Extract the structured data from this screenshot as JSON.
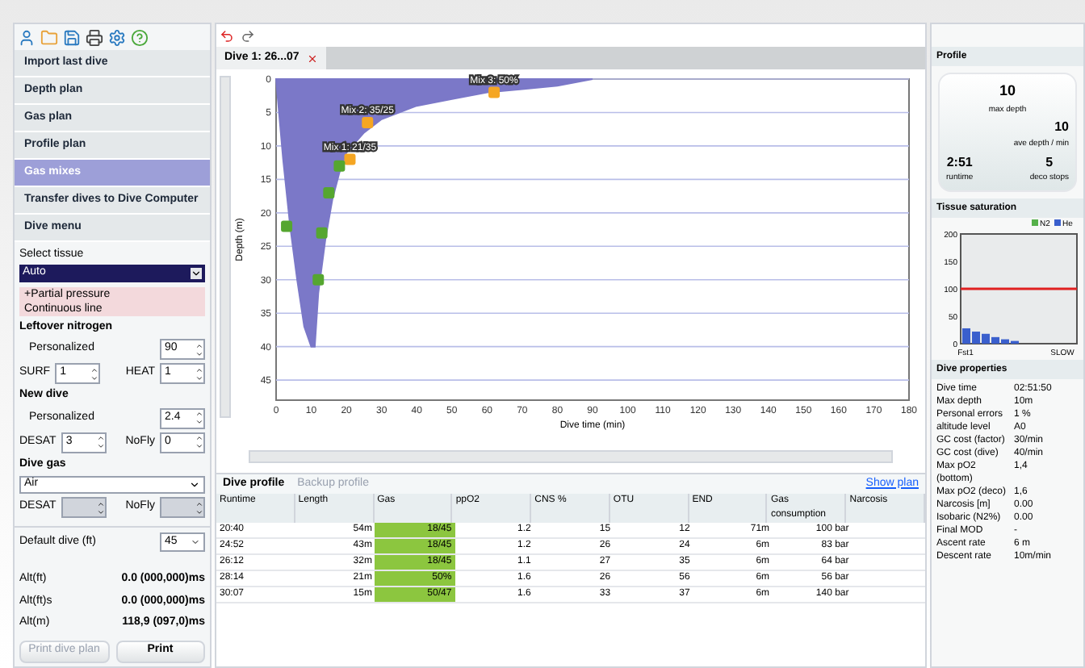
{
  "toolbar": {
    "icons": [
      {
        "kind": "user"
      },
      {
        "kind": "folder"
      },
      {
        "kind": "save"
      },
      {
        "kind": "print"
      },
      {
        "kind": "settings"
      },
      {
        "kind": "help"
      }
    ]
  },
  "nav": [
    {
      "label": "Import last dive",
      "selected": false
    },
    {
      "label": "Depth plan",
      "selected": false
    },
    {
      "label": "Gas plan",
      "selected": false
    },
    {
      "label": "Profile plan",
      "selected": false
    },
    {
      "label": "Gas mixes",
      "selected": true
    },
    {
      "label": "Transfer dives to Dive Computer",
      "selected": false
    },
    {
      "label": "Dive menu",
      "selected": false
    }
  ],
  "tissue": {
    "label": "Select tissue",
    "value": "Auto",
    "options": [
      {
        "label": "+Partial pressure"
      },
      {
        "label": "Continuous line"
      }
    ]
  },
  "sections": [
    {
      "title": "Leftover nitrogen",
      "personalized": {
        "label": "Personalized",
        "value": "90"
      },
      "fields": [
        {
          "label": "SURF",
          "value": "1",
          "disabled": false
        },
        {
          "label": "HEAT",
          "value": "1",
          "disabled": false
        }
      ]
    },
    {
      "title": "New dive",
      "personalized": {
        "label": "Personalized",
        "value": "2.4"
      },
      "fields": [
        {
          "label": "DESAT",
          "value": "3",
          "disabled": false
        },
        {
          "label": "NoFly",
          "value": "0",
          "disabled": false
        }
      ]
    }
  ],
  "dive_gas": {
    "title": "Dive gas",
    "value": "Air",
    "fields": [
      {
        "label": "DESAT",
        "disabled": true
      },
      {
        "label": "NoFly",
        "disabled": true
      }
    ]
  },
  "default_dive": {
    "label": "Default dive (ft)",
    "value": "45"
  },
  "totals": [
    {
      "label": "Alt(ft)",
      "value": "0.0 (000,000)ms"
    },
    {
      "label": "Alt(ft)s",
      "value": "0.0 (000,000)ms"
    },
    {
      "label": "Alt(m)",
      "value": "118,9 (097,0)ms"
    }
  ],
  "buttons": [
    "Print dive plan",
    "Print"
  ],
  "tab": {
    "label": "Dive 1: 26...07"
  },
  "chart_data": {
    "type": "area",
    "xlabel": "Dive time (min)",
    "ylabel": "Depth (m)",
    "x": [
      0,
      2,
      4,
      6,
      8,
      10,
      11,
      12,
      14,
      16,
      18,
      20,
      25,
      30,
      40,
      50,
      60,
      70,
      80,
      90
    ],
    "series": [
      {
        "color": "#7b78c8",
        "values": [
          0,
          12,
          22,
          30,
          37,
          40,
          40,
          32,
          24,
          18,
          14,
          11,
          8,
          6,
          4,
          3,
          2,
          1.5,
          1,
          0
        ]
      }
    ],
    "xlim": [
      0,
      180
    ],
    "ylim": [
      48,
      0
    ],
    "xticks": [
      0,
      10,
      20,
      30,
      40,
      50,
      60,
      70,
      80,
      90,
      100,
      110,
      120,
      130,
      140,
      150,
      160,
      170,
      180
    ],
    "yticks": [
      0,
      5,
      10,
      15,
      20,
      25,
      30,
      35,
      40,
      45
    ],
    "grid": true,
    "annotations": [
      {
        "x": 62,
        "y": 2,
        "text": "Mix 3: 50%"
      },
      {
        "x": 26,
        "y": 6.5,
        "text": "Mix 2: 35/25"
      },
      {
        "x": 21,
        "y": 12,
        "text": "Mix 1: 21/35"
      }
    ]
  },
  "profile_tabs": [
    {
      "label": "Dive profile",
      "selected": true
    },
    {
      "label": "Backup profile",
      "selected": false
    }
  ],
  "show_plan": "Show plan",
  "table": {
    "columns": [
      "Runtime",
      "Length",
      "Gas",
      "ppO2",
      "CNS %",
      "OTU",
      "END",
      "Gas consumption",
      "Narcosis"
    ],
    "rows": [
      [
        "20:40",
        "54m",
        "18/45",
        "1.2",
        "15",
        "12",
        "71m",
        "100 bar",
        ""
      ],
      [
        "24:52",
        "43m",
        "18/45",
        "1.2",
        "26",
        "24",
        "6m",
        "83 bar",
        ""
      ],
      [
        "26:12",
        "32m",
        "18/45",
        "1.1",
        "27",
        "35",
        "6m",
        "64 bar",
        ""
      ],
      [
        "28:14",
        "21m",
        "50%",
        "1.6",
        "26",
        "56",
        "6m",
        "56 bar",
        ""
      ],
      [
        "30:07",
        "15m",
        "50/47",
        "1.6",
        "33",
        "37",
        "6m",
        "140 bar",
        ""
      ]
    ]
  },
  "profile_card": {
    "title": "Profile",
    "stats": [
      {
        "value": "10",
        "label": "max depth"
      },
      {
        "value": "10",
        "label": "ave depth / min"
      },
      {
        "value": "2:51",
        "label": "runtime"
      },
      {
        "value": "5",
        "label": "deco stops"
      }
    ]
  },
  "tissue_chart_title": "Tissue saturation",
  "tissue_chart": {
    "chart_data": {
      "type": "bar",
      "stacked": true,
      "categories": [
        "Fst1",
        null,
        null,
        null,
        null,
        null,
        null,
        null,
        null,
        null,
        "SLOW",
        null
      ],
      "series": [
        {
          "name": "N2",
          "color": "#55b04a",
          "values": [
            0,
            0,
            0,
            0,
            0,
            0,
            0,
            0,
            0,
            0,
            0,
            0
          ]
        },
        {
          "name": "He",
          "color": "#3a5fcd",
          "values": [
            28,
            22,
            18,
            12,
            8,
            5,
            0,
            0,
            0,
            0,
            0,
            0
          ]
        }
      ],
      "ylim": [
        0,
        200
      ],
      "yticks": [
        0,
        50,
        100,
        150,
        200
      ],
      "ref_lines": [
        {
          "axis": "y",
          "value": 100
        }
      ]
    }
  },
  "properties": {
    "title": "Dive properties",
    "rows": [
      [
        "Dive time",
        "02:51:50"
      ],
      [
        "Max depth",
        "10m"
      ],
      [
        "Personal errors",
        "1 %"
      ],
      [
        "altitude level",
        "A0"
      ],
      [
        "GC cost (factor)",
        "30/min"
      ],
      [
        "GC cost (dive)",
        "40/min"
      ],
      [
        "Max pO2 (bottom)",
        "1,4"
      ],
      [
        "Max pO2 (deco)",
        "1,6"
      ],
      [
        "Narcosis [m]",
        "0.00"
      ],
      [
        "Isobaric (N2%)",
        "0.00"
      ],
      [
        "Final MOD",
        "-"
      ],
      [
        "Ascent rate",
        "6 m"
      ],
      [
        "Descent rate",
        "10m/min"
      ]
    ]
  }
}
